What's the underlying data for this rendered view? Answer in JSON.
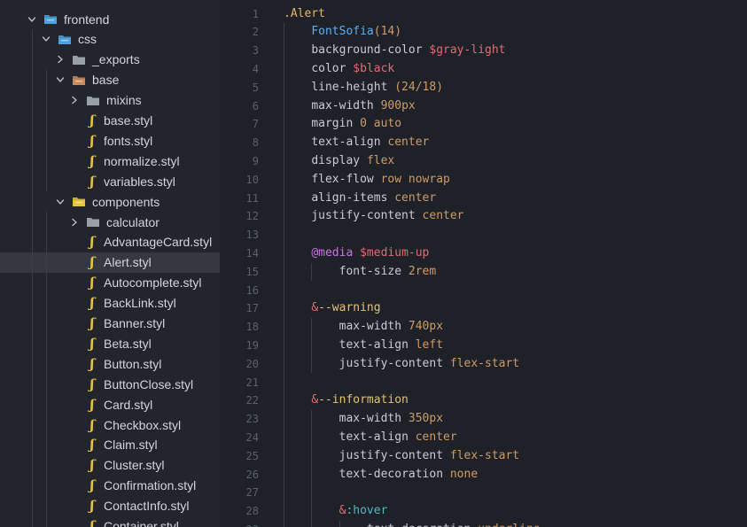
{
  "tree": [
    {
      "label": "frontend",
      "kind": "folder-open",
      "depth": 0,
      "chevron": "down",
      "icon": "folder-blue-icon"
    },
    {
      "label": "css",
      "kind": "folder-open",
      "depth": 1,
      "chevron": "down",
      "icon": "folder-blue-icon"
    },
    {
      "label": "_exports",
      "kind": "folder",
      "depth": 2,
      "chevron": "right",
      "icon": "folder-gray-icon"
    },
    {
      "label": "base",
      "kind": "folder-open",
      "depth": 2,
      "chevron": "down",
      "icon": "folder-brown-icon"
    },
    {
      "label": "mixins",
      "kind": "folder",
      "depth": 3,
      "chevron": "right",
      "icon": "folder-gray-icon"
    },
    {
      "label": "base.styl",
      "kind": "file",
      "depth": 3
    },
    {
      "label": "fonts.styl",
      "kind": "file",
      "depth": 3
    },
    {
      "label": "normalize.styl",
      "kind": "file",
      "depth": 3
    },
    {
      "label": "variables.styl",
      "kind": "file",
      "depth": 3
    },
    {
      "label": "components",
      "kind": "folder-open",
      "depth": 2,
      "chevron": "down",
      "icon": "folder-yellow-icon"
    },
    {
      "label": "calculator",
      "kind": "folder",
      "depth": 3,
      "chevron": "right",
      "icon": "folder-gray-icon"
    },
    {
      "label": "AdvantageCard.styl",
      "kind": "file",
      "depth": 3
    },
    {
      "label": "Alert.styl",
      "kind": "file",
      "depth": 3,
      "selected": true
    },
    {
      "label": "Autocomplete.styl",
      "kind": "file",
      "depth": 3
    },
    {
      "label": "BackLink.styl",
      "kind": "file",
      "depth": 3
    },
    {
      "label": "Banner.styl",
      "kind": "file",
      "depth": 3
    },
    {
      "label": "Beta.styl",
      "kind": "file",
      "depth": 3
    },
    {
      "label": "Button.styl",
      "kind": "file",
      "depth": 3
    },
    {
      "label": "ButtonClose.styl",
      "kind": "file",
      "depth": 3
    },
    {
      "label": "Card.styl",
      "kind": "file",
      "depth": 3
    },
    {
      "label": "Checkbox.styl",
      "kind": "file",
      "depth": 3
    },
    {
      "label": "Claim.styl",
      "kind": "file",
      "depth": 3
    },
    {
      "label": "Cluster.styl",
      "kind": "file",
      "depth": 3
    },
    {
      "label": "Confirmation.styl",
      "kind": "file",
      "depth": 3
    },
    {
      "label": "ContactInfo.styl",
      "kind": "file",
      "depth": 3
    },
    {
      "label": "Container.styl",
      "kind": "file",
      "depth": 3
    }
  ],
  "file_icon_glyph": "ʃ",
  "code_lines": [
    {
      "n": "1",
      "indent": 0,
      "tokens": [
        {
          "t": ".Alert",
          "c": "sel"
        }
      ]
    },
    {
      "n": "2",
      "indent": 1,
      "tokens": [
        {
          "t": "FontSofia",
          "c": "fn"
        },
        {
          "t": "(14)",
          "c": "num"
        }
      ]
    },
    {
      "n": "3",
      "indent": 1,
      "tokens": [
        {
          "t": "background-color ",
          "c": "prop"
        },
        {
          "t": "$gray-light",
          "c": "var"
        }
      ]
    },
    {
      "n": "4",
      "indent": 1,
      "tokens": [
        {
          "t": "color ",
          "c": "prop"
        },
        {
          "t": "$black",
          "c": "var"
        }
      ]
    },
    {
      "n": "5",
      "indent": 1,
      "tokens": [
        {
          "t": "line-height ",
          "c": "prop"
        },
        {
          "t": "(24/18)",
          "c": "num"
        }
      ]
    },
    {
      "n": "6",
      "indent": 1,
      "tokens": [
        {
          "t": "max-width ",
          "c": "prop"
        },
        {
          "t": "900px",
          "c": "num"
        }
      ]
    },
    {
      "n": "7",
      "indent": 1,
      "tokens": [
        {
          "t": "margin ",
          "c": "prop"
        },
        {
          "t": "0 auto",
          "c": "num"
        }
      ]
    },
    {
      "n": "8",
      "indent": 1,
      "tokens": [
        {
          "t": "text-align ",
          "c": "prop"
        },
        {
          "t": "center",
          "c": "kw"
        }
      ]
    },
    {
      "n": "9",
      "indent": 1,
      "tokens": [
        {
          "t": "display ",
          "c": "prop"
        },
        {
          "t": "flex",
          "c": "kw"
        }
      ]
    },
    {
      "n": "10",
      "indent": 1,
      "tokens": [
        {
          "t": "flex-flow ",
          "c": "prop"
        },
        {
          "t": "row nowrap",
          "c": "kw"
        }
      ]
    },
    {
      "n": "11",
      "indent": 1,
      "tokens": [
        {
          "t": "align-items ",
          "c": "prop"
        },
        {
          "t": "center",
          "c": "kw"
        }
      ]
    },
    {
      "n": "12",
      "indent": 1,
      "tokens": [
        {
          "t": "justify-content ",
          "c": "prop"
        },
        {
          "t": "center",
          "c": "kw"
        }
      ]
    },
    {
      "n": "13",
      "indent": 0,
      "tokens": []
    },
    {
      "n": "14",
      "indent": 1,
      "tokens": [
        {
          "t": "@media ",
          "c": "at"
        },
        {
          "t": "$medium-up",
          "c": "var"
        }
      ]
    },
    {
      "n": "15",
      "indent": 2,
      "tokens": [
        {
          "t": "font-size ",
          "c": "prop"
        },
        {
          "t": "2rem",
          "c": "num"
        }
      ]
    },
    {
      "n": "16",
      "indent": 0,
      "tokens": []
    },
    {
      "n": "17",
      "indent": 1,
      "tokens": [
        {
          "t": "&",
          "c": "amp"
        },
        {
          "t": "--warning",
          "c": "mod"
        }
      ]
    },
    {
      "n": "18",
      "indent": 2,
      "tokens": [
        {
          "t": "max-width ",
          "c": "prop"
        },
        {
          "t": "740px",
          "c": "num"
        }
      ]
    },
    {
      "n": "19",
      "indent": 2,
      "tokens": [
        {
          "t": "text-align ",
          "c": "prop"
        },
        {
          "t": "left",
          "c": "kw"
        }
      ]
    },
    {
      "n": "20",
      "indent": 2,
      "tokens": [
        {
          "t": "justify-content ",
          "c": "prop"
        },
        {
          "t": "flex-start",
          "c": "kw"
        }
      ]
    },
    {
      "n": "21",
      "indent": 0,
      "tokens": []
    },
    {
      "n": "22",
      "indent": 1,
      "tokens": [
        {
          "t": "&",
          "c": "amp"
        },
        {
          "t": "--information",
          "c": "mod"
        }
      ]
    },
    {
      "n": "23",
      "indent": 2,
      "tokens": [
        {
          "t": "max-width ",
          "c": "prop"
        },
        {
          "t": "350px",
          "c": "num"
        }
      ]
    },
    {
      "n": "24",
      "indent": 2,
      "tokens": [
        {
          "t": "text-align ",
          "c": "prop"
        },
        {
          "t": "center",
          "c": "kw"
        }
      ]
    },
    {
      "n": "25",
      "indent": 2,
      "tokens": [
        {
          "t": "justify-content ",
          "c": "prop"
        },
        {
          "t": "flex-start",
          "c": "kw"
        }
      ]
    },
    {
      "n": "26",
      "indent": 2,
      "tokens": [
        {
          "t": "text-decoration ",
          "c": "prop"
        },
        {
          "t": "none",
          "c": "kw"
        }
      ]
    },
    {
      "n": "27",
      "indent": 0,
      "tokens": []
    },
    {
      "n": "28",
      "indent": 2,
      "tokens": [
        {
          "t": "&",
          "c": "amp"
        },
        {
          "t": ":hover",
          "c": "pseudo"
        }
      ]
    },
    {
      "n": "29",
      "indent": 3,
      "tokens": [
        {
          "t": "text-decoration ",
          "c": "prop"
        },
        {
          "t": "underline",
          "c": "kw"
        }
      ]
    }
  ],
  "colors": {
    "folder_blue": "#4aa3df",
    "folder_gray": "#9aa0a8",
    "folder_brown": "#c9895a",
    "folder_yellow": "#e8c142",
    "styl_icon": "#e8c142"
  }
}
